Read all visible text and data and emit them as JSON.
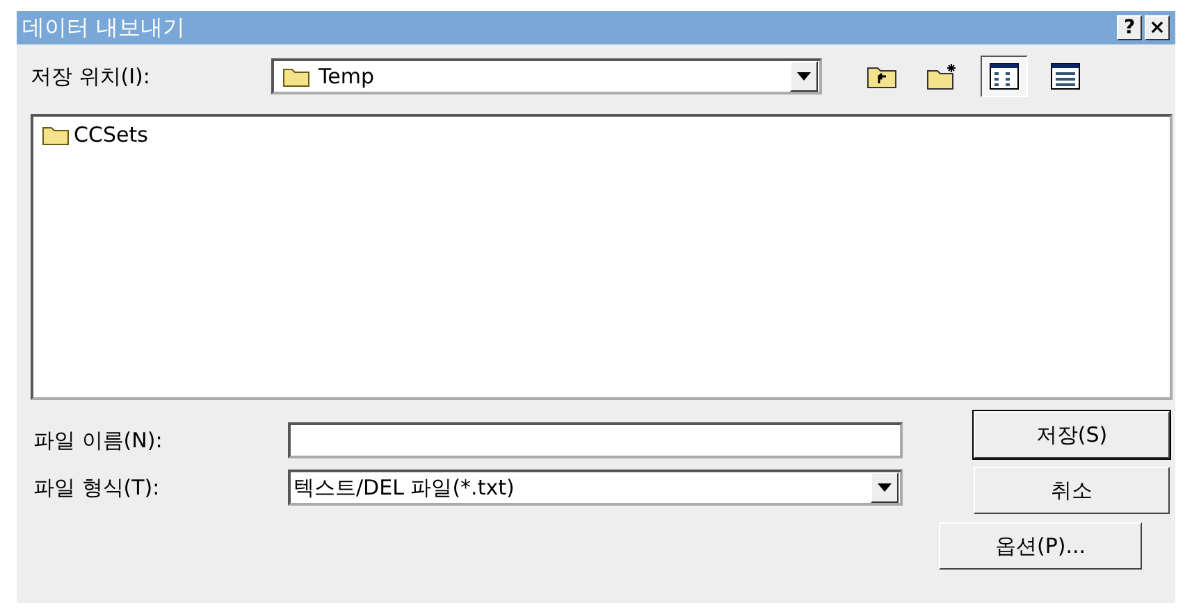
{
  "window": {
    "title": "데이터 내보내기",
    "buttons": [
      "?",
      "×"
    ]
  },
  "location": {
    "label": "저장 위치(I):",
    "value": "Temp"
  },
  "toolbar": [
    {
      "kind": "up"
    },
    {
      "kind": "newfolder"
    },
    {
      "kind": "list",
      "selected": true
    },
    {
      "kind": "details",
      "selected": false
    }
  ],
  "files": [
    {
      "name": "CCSets",
      "kind": "folder",
      "selected": false
    }
  ],
  "file_name": {
    "label": "파일 이름(N):"
  },
  "file_type": {
    "label": "파일 형식(T):",
    "value": "텍스트/DEL 파일(*.txt)"
  },
  "buttons": [
    {
      "label": "저장(S)",
      "default": true
    },
    {
      "label": "취소",
      "default": false
    },
    {
      "label": "옵션(P)...",
      "default": false
    }
  ]
}
